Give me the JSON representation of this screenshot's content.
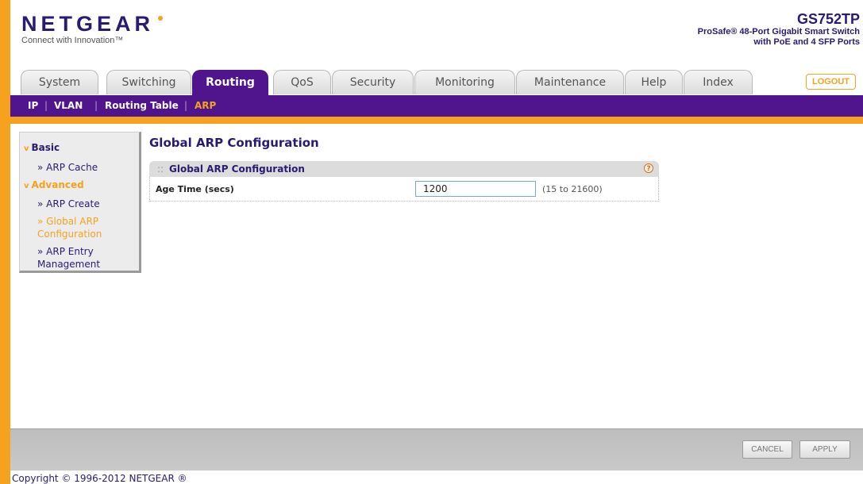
{
  "header": {
    "logo": "NETGEAR",
    "tagline": "Connect with Innovation™",
    "model_name": "GS752TP",
    "model_desc_line1": "ProSafe® 48-Port Gigabit Smart Switch",
    "model_desc_line2": "with PoE and 4 SFP Ports",
    "logout_label": "LOGOUT"
  },
  "tabs": [
    {
      "label": "System"
    },
    {
      "label": "Switching"
    },
    {
      "label": "Routing",
      "active": true
    },
    {
      "label": "QoS"
    },
    {
      "label": "Security"
    },
    {
      "label": "Monitoring"
    },
    {
      "label": "Maintenance"
    },
    {
      "label": "Help"
    },
    {
      "label": "Index"
    }
  ],
  "subnav": {
    "items": [
      "IP",
      "VLAN",
      "Routing Table",
      "ARP"
    ],
    "separator": "|",
    "active": "ARP"
  },
  "sidebar": {
    "groups": [
      {
        "label": "Basic",
        "arrow": "v",
        "items": [
          {
            "label": "» ARP Cache"
          }
        ]
      },
      {
        "label": "Advanced",
        "arrow": "v",
        "items": [
          {
            "label": "» ARP Create"
          },
          {
            "label_line1": "» Global ARP",
            "label_line2": "Configuration",
            "active": true
          },
          {
            "label_line1": "» ARP Entry",
            "label_line2": "Management"
          }
        ]
      }
    ]
  },
  "main": {
    "page_title": "Global ARP Configuration",
    "panel_dots": "::",
    "panel_title": "Global ARP Configuration",
    "help_icon": "?",
    "age_time_label": "Age Time (secs)",
    "age_time_value": "1200",
    "age_time_range": "(15 to 21600)"
  },
  "footer": {
    "cancel_label": "CANCEL",
    "apply_label": "APPLY",
    "copyright": "Copyright © 1996-2012 NETGEAR ®"
  },
  "colors": {
    "brand_purple": "#50148c",
    "brand_orange": "#f6a21e",
    "text_navy": "#2a1a74"
  }
}
